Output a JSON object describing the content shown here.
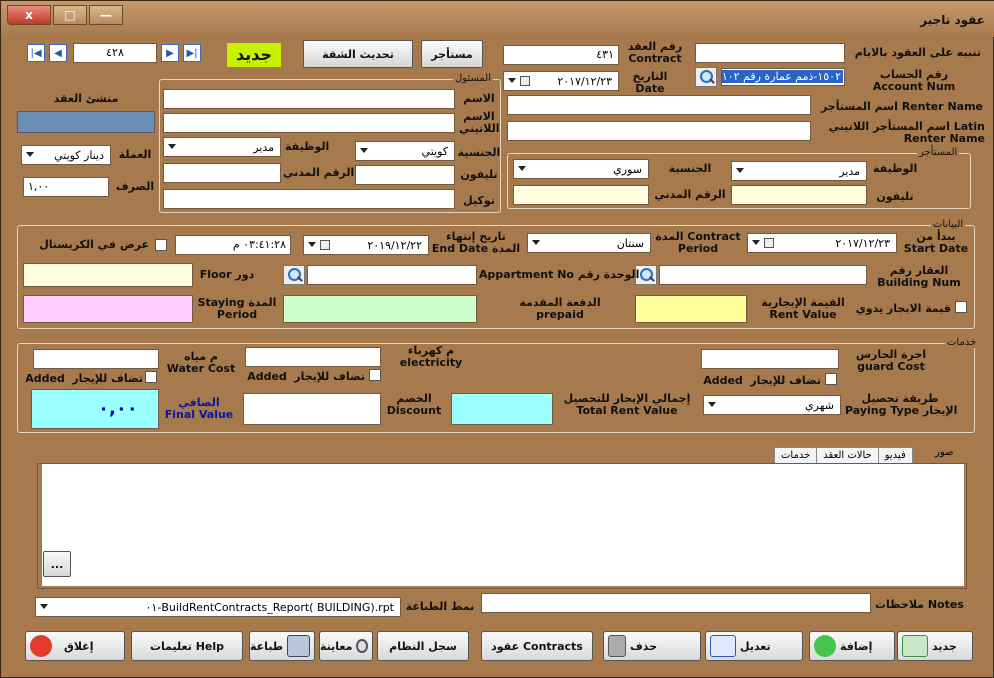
{
  "window": {
    "title": "عقود تاجير",
    "close": "x",
    "max": "□",
    "min": "—"
  },
  "nav": {
    "record": "٤٢٨"
  },
  "top": {
    "new_badge": "جديد",
    "update_apt": "تحديث الشقة",
    "renter_btn": "مستأجر",
    "contract_no_label": "رقم العقد\nContract",
    "contract_no": "٤٣١",
    "date_label": "التاريخ\nDate",
    "date": "٢٠١٧/١٢/٢٣",
    "alert_label": "تنبيه على العقود بالايام",
    "alert_value": "",
    "account_label": "رقم الحساب\nAccount Num",
    "account_value": "١٥٠٢-ذمم عمارة رقم ١٠٢",
    "renter_name_label": "اسم المستأجر Renter Name",
    "renter_name": "",
    "renter_latin_label": "اسم المستأجر اللاتيني Latin\nRenter Name",
    "renter_latin": ""
  },
  "contract_creator": {
    "label": "منشئ العقد"
  },
  "currency": {
    "label": "العملة",
    "value": "دينار كويتي",
    "rate_label": "الصرف",
    "rate": "١,٠٠"
  },
  "responsible": {
    "title": "المسئول",
    "name_label": "الاسم",
    "latin_label": "الاسم\nاللاتيني",
    "job_label": "الوظيفة",
    "job": "مدير",
    "nationality_label": "الجنسية",
    "nationality": "كويتي",
    "phone_label": "تليفون",
    "civil_label": "الرقم المدني",
    "agent_label": "توكيل"
  },
  "renter": {
    "title": "المستأجر",
    "job_label": "الوظيفة",
    "job": "مدير",
    "nationality_label": "الجنسية",
    "nationality": "سوري",
    "phone_label": "تليفون",
    "civil_label": "الرقم المدني"
  },
  "data": {
    "title": "البيانات",
    "start_label": "يبدأ من\nStart Date",
    "start": "٢٠١٧/١٢/٢٣",
    "period_label": "المدة Contract\nPeriod",
    "period": "سنتان",
    "end_label": "تاريخ إنتهاء\nEnd Date المدة",
    "end": "٢٠١٩/١٢/٢٢",
    "time": "٠٣:٤١:٢٨ م",
    "show_kurdistan": "عرض في الكريستال",
    "building_label": "العقار رقم\nBuilding Num",
    "unit_label": "Appartment No الوحدة رقم",
    "floor_label": "Floor دور",
    "manual_rent": "قيمة الايجار يدوي",
    "rent_label": "القيمة الإيجارية\nRent Value",
    "prepaid_label": "الدفعة المقدمة\nprepaid",
    "stay_label": "Staying المدة\nPeriod"
  },
  "services": {
    "title": "خدمات",
    "guard_label": "اجرة الحارس\nguard Cost",
    "electric_label": "م كهرباء\nelectricity",
    "water_label": "م مياه\nWater Cost",
    "added_label": "Added",
    "added_rent": "تضاف للإيجار",
    "pay_label": "طريقة تحصيل\nPaying Type الإيجار",
    "pay_value": "شهري",
    "total_label": "إجمالي الإيجار للتحصيل\nTotal Rent Value",
    "discount_label": "الخصم\nDiscount",
    "final_label": "الصافي\nFinal Value",
    "final_value": "٠,٠٠"
  },
  "tabs": [
    "صور",
    "فيديو",
    "حالات العقد",
    "خدمات"
  ],
  "browse": "...",
  "bottom": {
    "notes_label": "ملاحظات Notes",
    "print_label": "نمط الطباعة",
    "print_value": "BuildRentContracts_Report( BUILDING).rpt-٠١"
  },
  "buttons": {
    "new": "جديد",
    "add": "إضافة",
    "edit": "تعديل",
    "delete": "حذف",
    "contracts": "عقود Contracts",
    "log": "سجل النظام",
    "preview": "معاينة",
    "print": "طباعة",
    "help": "تعليمات Help",
    "close": "إغلاق"
  }
}
